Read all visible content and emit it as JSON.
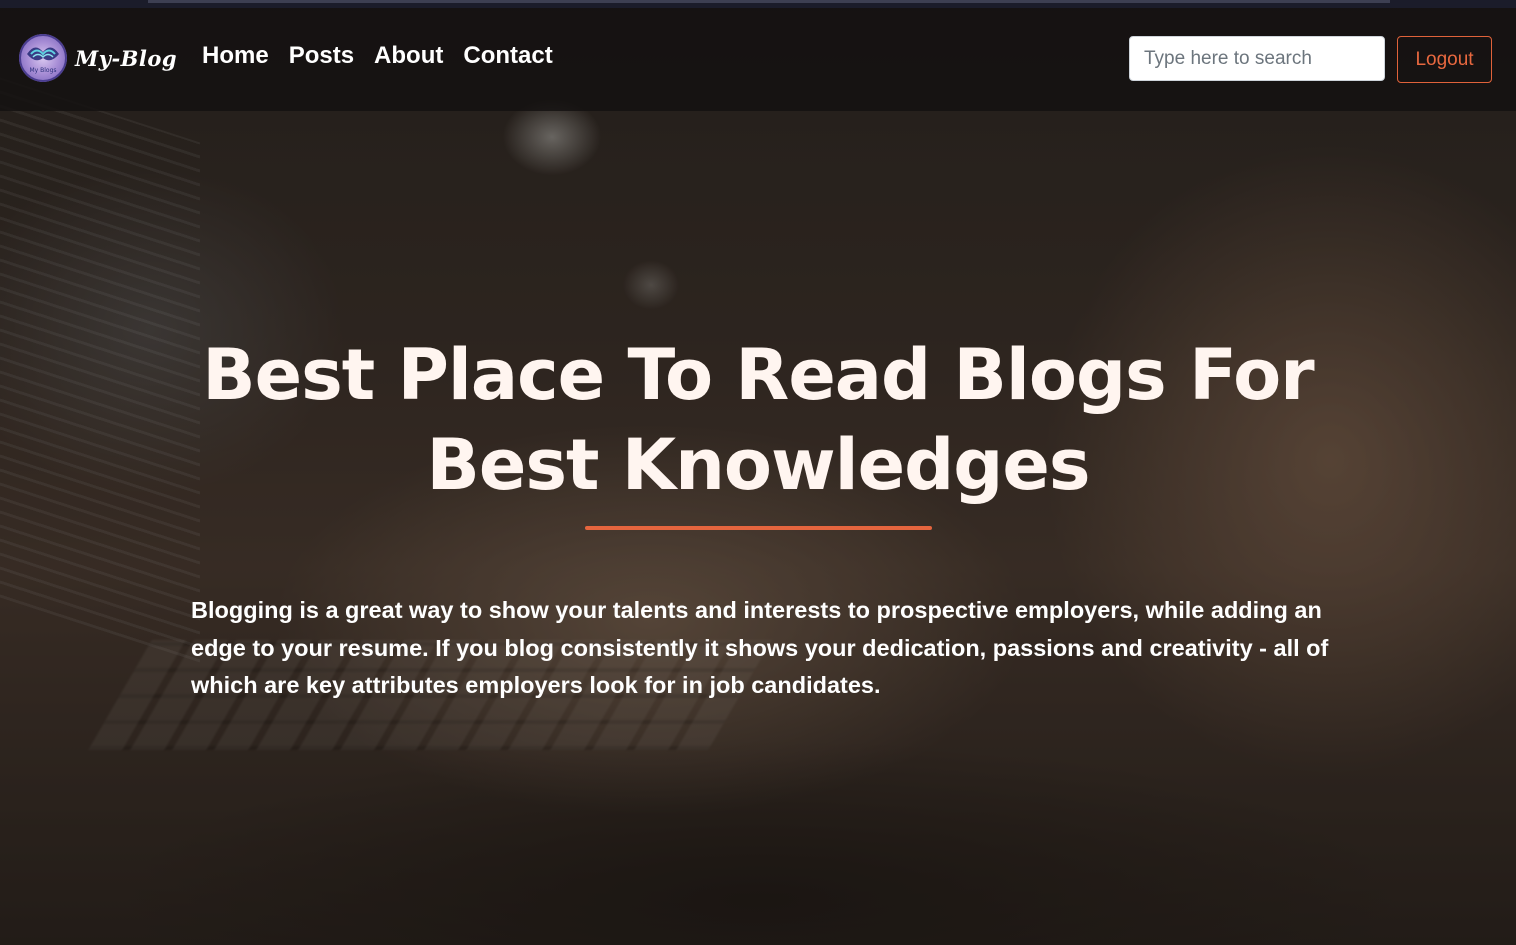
{
  "brand": {
    "name": "My-Blog",
    "logo_text": "My Blogs",
    "logo_icon": "my-blog-logo-icon"
  },
  "nav": {
    "items": [
      {
        "label": "Home"
      },
      {
        "label": "Posts"
      },
      {
        "label": "About"
      },
      {
        "label": "Contact"
      }
    ]
  },
  "search": {
    "placeholder": "Type here to search",
    "value": ""
  },
  "auth": {
    "logout_label": "Logout"
  },
  "hero": {
    "title": "Best Place To Read Blogs For Best Knowledges",
    "text": "Blogging is a great way to show your talents and interests to prospective employers, while adding an edge to your resume. If you blog consistently it shows your dedication, passions and creativity - all of which are key attributes employers look for in job candidates."
  },
  "colors": {
    "accent": "#e5653e",
    "navbar_bg": "#121010",
    "title_text": "#fff5f0"
  }
}
